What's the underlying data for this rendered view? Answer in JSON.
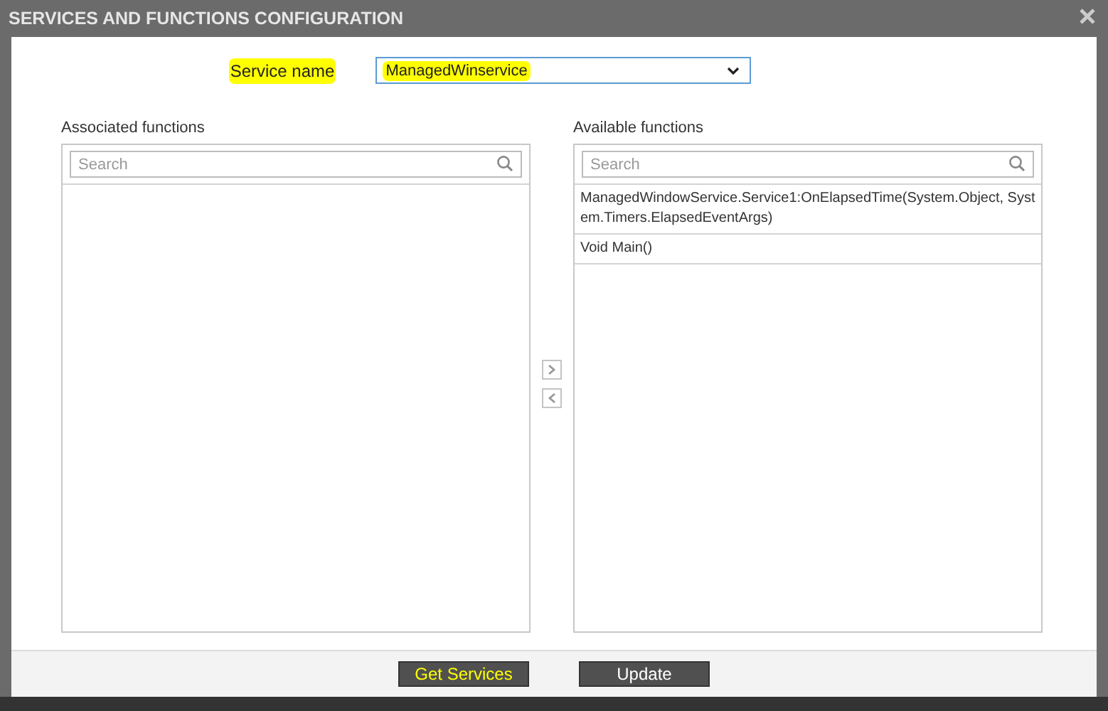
{
  "window": {
    "title": "SERVICES AND FUNCTIONS CONFIGURATION"
  },
  "service_name": {
    "label": "Service name",
    "label_highlighted": true,
    "value": "ManagedWinservice",
    "value_highlighted": true
  },
  "associated": {
    "title": "Associated functions",
    "search": {
      "placeholder": "Search"
    }
  },
  "available": {
    "title": "Available functions",
    "search": {
      "placeholder": "Search"
    },
    "items": [
      {
        "text": "ManagedWindowService.Service1:OnElapsedTime(System.Object, System.Timers.ElapsedEventArgs)"
      },
      {
        "text": "Void Main()"
      }
    ]
  },
  "buttons": [
    {
      "label": "Get Services",
      "highlighted": true
    },
    {
      "label": "Update",
      "highlighted": false
    }
  ]
}
